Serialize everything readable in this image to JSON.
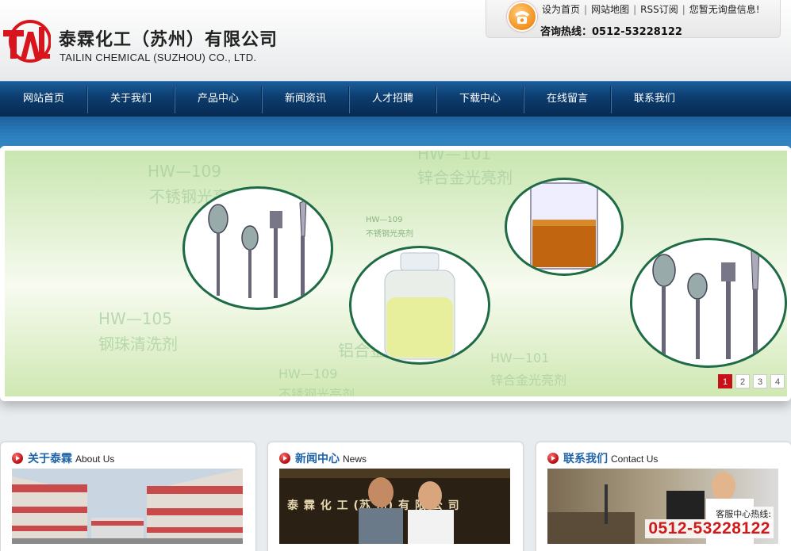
{
  "header": {
    "company_cn": "泰霖化工（苏州）有限公司",
    "company_en": "TAILIN CHEMICAL (SUZHOU) CO., LTD.",
    "logo_text": "TAL",
    "top_links": [
      "设为首页",
      "网站地图",
      "RSS订阅",
      "您暂无询盘信息!"
    ],
    "hotline_label": "咨询热线：",
    "hotline_number": "0512-53228122"
  },
  "nav": {
    "items": [
      "网站首页",
      "关于我们",
      "产品中心",
      "新闻资讯",
      "人才招聘",
      "下载中心",
      "在线留言",
      "联系我们"
    ]
  },
  "banner": {
    "watermarks": [
      "HW—109",
      "不锈钢光亮剂",
      "HW—105",
      "钢珠清洗剂",
      "HW—109",
      "不锈钢光亮剂",
      "HW—101",
      "锌合金光亮剂",
      "HW—101",
      "锌合金光亮剂",
      "铝合金光",
      "HW—109",
      "不锈钢光亮剂"
    ],
    "slides": [
      "1",
      "2",
      "3",
      "4"
    ],
    "active_slide": 1
  },
  "panels": {
    "about": {
      "title_cn": "关于泰霖",
      "title_en": "About Us"
    },
    "news": {
      "title_cn": "新闻中心",
      "title_en": "News",
      "photo_text": "泰 霖 化 工 (苏 州) 有 限 公 司"
    },
    "contact": {
      "title_cn": "联系我们",
      "title_en": "Contact Us",
      "hotline_label": "客服中心热线:",
      "hotline_number": "0512-53228122"
    }
  },
  "colors": {
    "nav_bg": "#0c3c6e",
    "title_blue": "#1f64a8",
    "accent_red": "#c8101a"
  }
}
